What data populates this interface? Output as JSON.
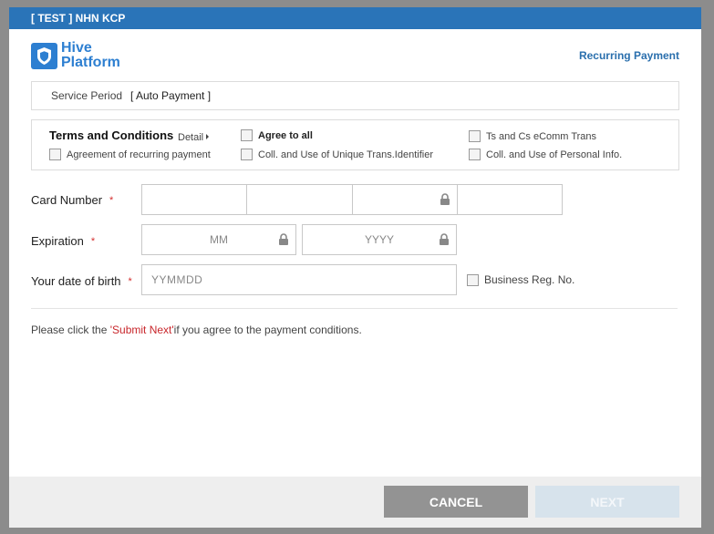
{
  "window": {
    "title": "[ TEST ] NHN KCP"
  },
  "header": {
    "logo_line1": "Hive",
    "logo_line2": "Platform",
    "recurring_label": "Recurring Payment"
  },
  "service": {
    "label": "Service Period",
    "value": "[ Auto Payment ]"
  },
  "terms": {
    "title": "Terms and Conditions",
    "detail_label": "Detail",
    "agree_all": "Agree to all",
    "items": [
      {
        "label": "Ts and Cs eComm Trans",
        "checked": false
      },
      {
        "label": "Agreement of recurring payment",
        "checked": false
      },
      {
        "label": "Coll. and Use of Unique Trans.Identifier",
        "checked": false
      },
      {
        "label": "Coll. and Use of Personal Info.",
        "checked": false
      }
    ]
  },
  "form": {
    "required_mark": "*",
    "card_number_label": "Card Number",
    "expiration_label": "Expiration",
    "month_placeholder": "MM",
    "year_placeholder": "YYYY",
    "dob_label": "Your date of birth",
    "dob_placeholder": "YYMMDD",
    "business_reg_label": "Business Reg. No."
  },
  "notice": {
    "prefix": "Please click the ",
    "highlight": "'Submit Next'",
    "suffix": "if you agree to the payment conditions."
  },
  "footer": {
    "cancel_label": "CANCEL",
    "next_label": "NEXT"
  },
  "colors": {
    "titlebar": "#2a74b8",
    "brand": "#2d7fd1",
    "required": "#d42d2d",
    "highlight": "#c8262b",
    "cancel_button": "#939393",
    "next_button_disabled": "#d7e3ec"
  },
  "icons": [
    "hive-logo-icon",
    "detail-arrow-icon",
    "lock-icon"
  ]
}
